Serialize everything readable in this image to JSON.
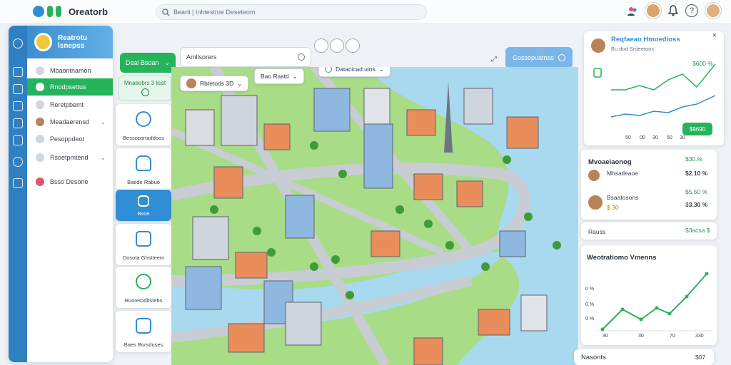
{
  "app": {
    "name": "Oreatorb"
  },
  "topbar": {
    "search_placeholder": "Bearti | Inhtestroe Deseteom"
  },
  "sidebar": {
    "brand": "Reatrotu lsnepss",
    "items": [
      {
        "label": "Mbaontnamon"
      },
      {
        "label": "Rnodpsettus"
      },
      {
        "label": "Reretpbemt"
      },
      {
        "label": "Meadaerensd"
      },
      {
        "label": "Pesoppdeot"
      },
      {
        "label": "Rsoetpmtend"
      },
      {
        "label": "Bsso Desone"
      }
    ]
  },
  "toolbar": {
    "primary_button": "Deal Bsoan",
    "primary_chevron": "⌄",
    "input_value": "Amllsorers",
    "secondary_button": "Gossopuatnas"
  },
  "tools": {
    "header": "Mnaeebrs 3 lisst",
    "cards": [
      {
        "label": "Bessopsrtaddoos"
      },
      {
        "label": "Baede Rabuo"
      },
      {
        "label": "Bsoe"
      },
      {
        "label": "Dosota Ghstteem"
      },
      {
        "label": "Ruoretodbstebs"
      },
      {
        "label": "Baes Borsduses"
      }
    ]
  },
  "map": {
    "chips": [
      {
        "label": "Rbtetods 3D",
        "chevron": "⌄"
      },
      {
        "label": "Bao Rastd",
        "chevron": "⌄"
      },
      {
        "label": "Datacicad:uins",
        "chevron": "⌄"
      }
    ]
  },
  "right_panel": {
    "profile": {
      "title": "Reqfaeao Hmoedioss",
      "subtitle": "Bu dod Srdeetoos",
      "top_value": "$600 %",
      "axis_labels": [
        "50",
        "00",
        "30",
        "50",
        "30"
      ],
      "action": "$9690"
    },
    "metrics": {
      "title": "Mvoaeiaonog",
      "title_value": "$30.%",
      "rows": [
        {
          "label": "Mhsatleaoe",
          "value": "$2.10 %"
        },
        {
          "label": "Bsaatosons",
          "value": "$5.50 %"
        },
        {
          "label": "$ 30",
          "value": "33.30 %"
        }
      ]
    },
    "summary": {
      "label": "Rauss",
      "value": "$3acsa $"
    },
    "growth": {
      "title": "Weotratiomo Vmenns",
      "y_labels": [
        "0 %",
        "0 %",
        "0 %"
      ],
      "x_labels": [
        "30",
        "30",
        "70",
        "330"
      ]
    },
    "footer": {
      "label": "Nasonts",
      "value": "$07"
    }
  },
  "colors": {
    "accent_green": "#27b35a",
    "accent_blue": "#2f8ed6",
    "water": "#a9d9ef",
    "grass": "#a9dc86"
  }
}
